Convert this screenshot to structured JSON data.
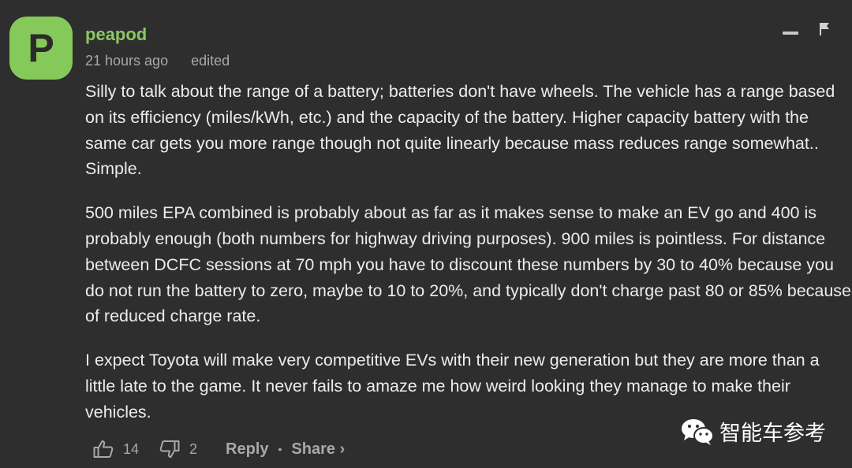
{
  "comment": {
    "avatar_letter": "P",
    "username": "peapod",
    "timestamp": "21 hours ago",
    "edited_label": "edited",
    "paragraphs": [
      "Silly to talk about the range of a battery; batteries don't have wheels. The vehicle has a range based on its efficiency (miles/kWh, etc.) and the capacity of the battery. Higher capacity battery with the same car gets you more range though not quite linearly because mass reduces range somewhat.. Simple.",
      "500 miles EPA combined is probably about as far as it makes sense to make an EV go and 400 is probably enough (both numbers for highway driving purposes). 900 miles is pointless. For distance between DCFC sessions at 70 mph you have to discount these numbers by 30 to 40% because you do not run the battery to zero, maybe to 10 to 20%, and typically don't charge past 80 or 85% because of reduced charge rate.",
      "I expect Toyota will make very competitive EVs with their new generation but they are more than a little late to the game. It never fails to amaze me how weird looking they manage to make their vehicles."
    ],
    "likes": "14",
    "dislikes": "2",
    "reply_label": "Reply",
    "separator": "•",
    "share_label": "Share ›"
  },
  "watermark": {
    "text": "智能车参考",
    "icon": "wechat-icon"
  },
  "colors": {
    "background": "#2e2e2e",
    "avatar": "#85c95a",
    "username": "#8cc862",
    "meta": "#a8a8a8",
    "body_text": "#ececec"
  }
}
